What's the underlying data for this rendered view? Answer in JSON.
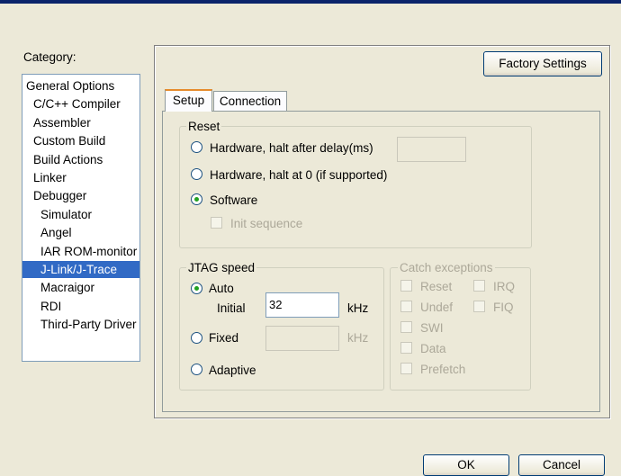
{
  "category": {
    "label": "Category:",
    "items": [
      {
        "label": "General Options",
        "indent": 0
      },
      {
        "label": "C/C++ Compiler",
        "indent": 1
      },
      {
        "label": "Assembler",
        "indent": 1
      },
      {
        "label": "Custom Build",
        "indent": 1
      },
      {
        "label": "Build Actions",
        "indent": 1
      },
      {
        "label": "Linker",
        "indent": 1
      },
      {
        "label": "Debugger",
        "indent": 1
      },
      {
        "label": "Simulator",
        "indent": 2
      },
      {
        "label": "Angel",
        "indent": 2
      },
      {
        "label": "IAR ROM-monitor",
        "indent": 2
      },
      {
        "label": "J-Link/J-Trace",
        "indent": 2,
        "selected": true
      },
      {
        "label": "Macraigor",
        "indent": 2
      },
      {
        "label": "RDI",
        "indent": 2
      },
      {
        "label": "Third-Party Driver",
        "indent": 2
      }
    ]
  },
  "factory_settings_label": "Factory Settings",
  "tabs": [
    {
      "label": "Setup",
      "active": true
    },
    {
      "label": "Connection",
      "active": false
    }
  ],
  "reset": {
    "title": "Reset",
    "hw_delay_label": "Hardware, halt after delay(ms)",
    "hw_delay_value": "",
    "hw_halt0_label": "Hardware, halt at 0 (if supported)",
    "software_label": "Software",
    "init_sequence_label": "Init sequence",
    "selected": "software"
  },
  "jtag": {
    "title": "JTAG speed",
    "auto_label": "Auto",
    "initial_label": "Initial",
    "initial_value": "32",
    "khz_label": "kHz",
    "fixed_label": "Fixed",
    "fixed_value": "",
    "fixed_khz_label": "kHz",
    "adaptive_label": "Adaptive",
    "selected": "auto"
  },
  "catch": {
    "title": "Catch exceptions",
    "reset_label": "Reset",
    "undef_label": "Undef",
    "swi_label": "SWI",
    "data_label": "Data",
    "prefetch_label": "Prefetch",
    "irq_label": "IRQ",
    "fiq_label": "FIQ"
  },
  "footer": {
    "ok_label": "OK",
    "cancel_label": "Cancel"
  },
  "colors": {
    "selection": "#316ac5",
    "radio_dot": "#21a121",
    "title_bar": "#0a246a"
  }
}
